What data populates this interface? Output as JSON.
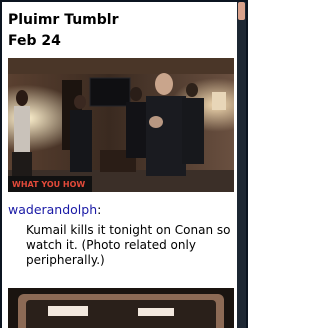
{
  "app": {
    "title": "Pluimr Tumblr"
  },
  "post": {
    "date": "Feb 24",
    "author": "waderandolph",
    "author_suffix": ":",
    "caption": "Kumail kills it tonight on Conan so watch it. (Photo related only peripherally.)",
    "photo_sign_text": "WHAT YOU HOW"
  },
  "colors": {
    "link": "#1a1aa6",
    "scroll_thumb": "#d9a28c",
    "frame": "#0b1420"
  }
}
